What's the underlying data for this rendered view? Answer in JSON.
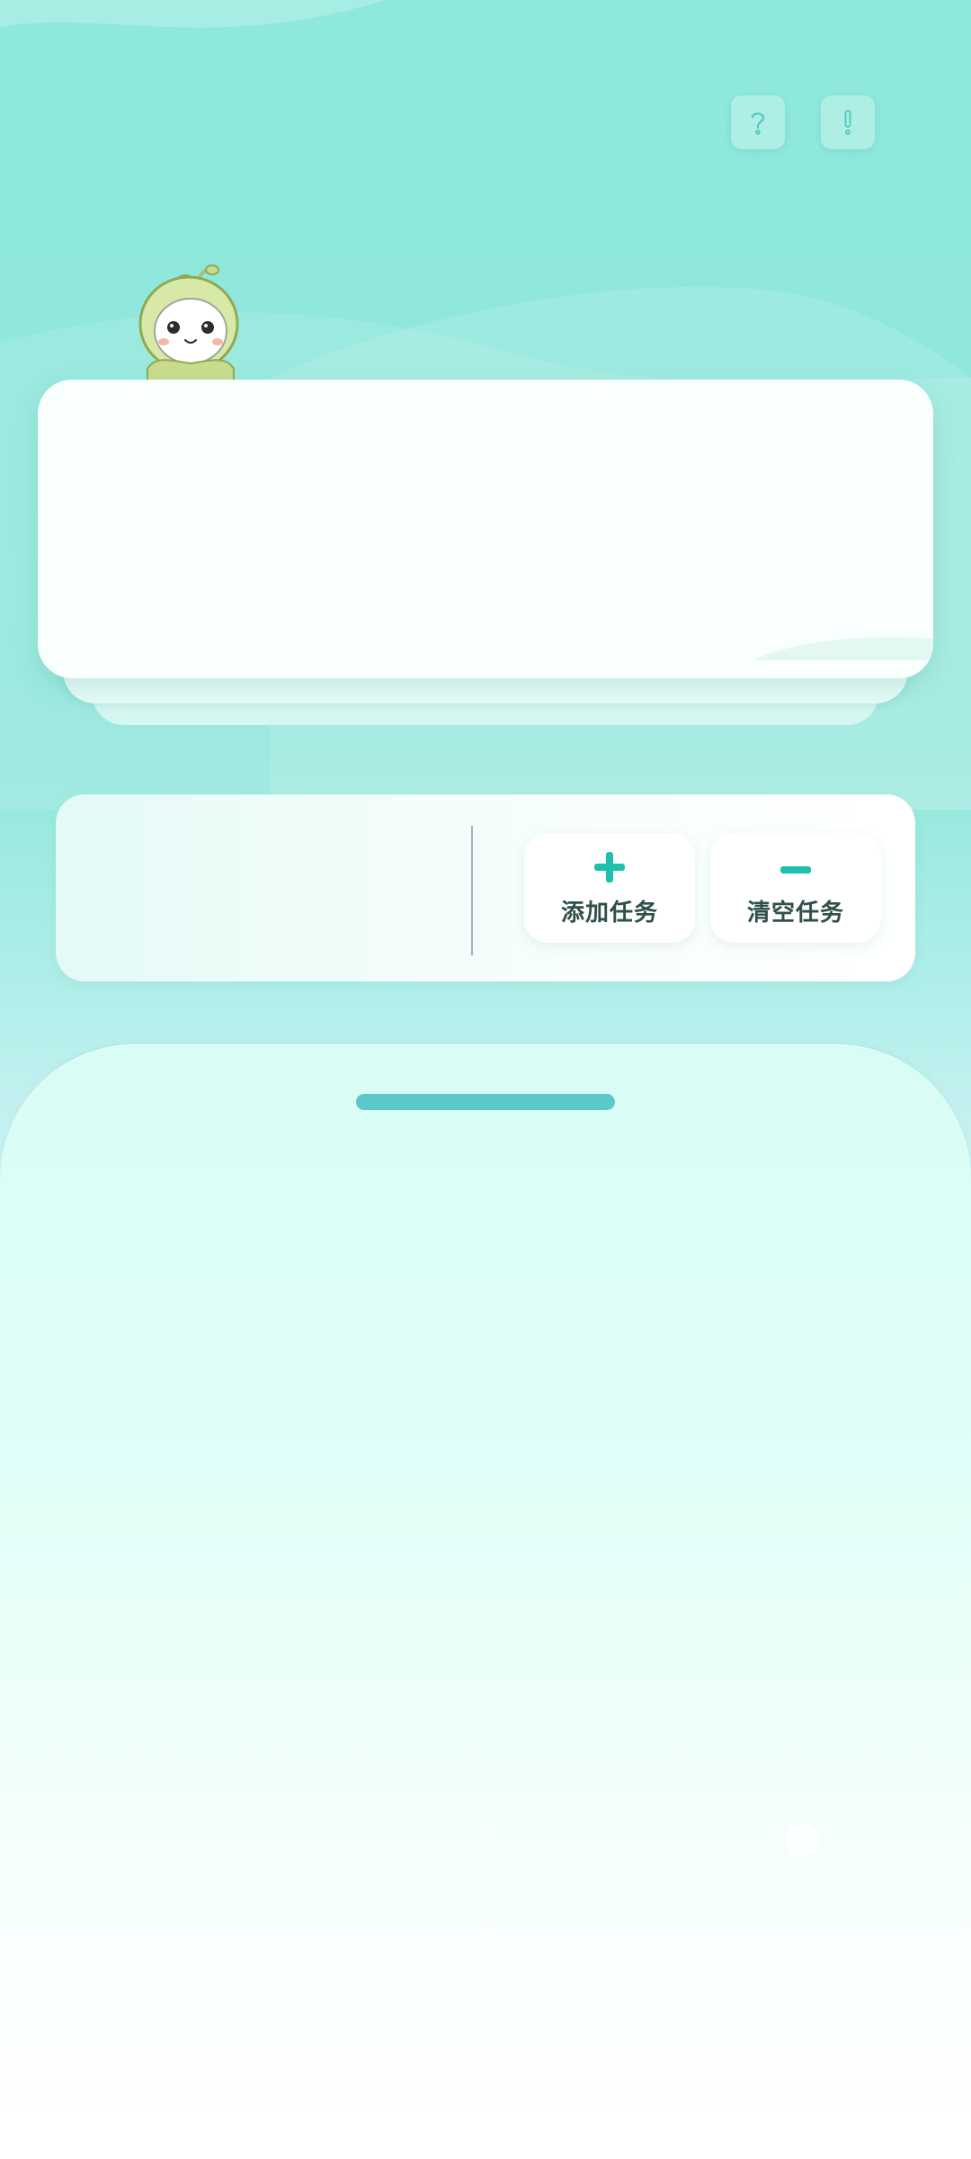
{
  "header": {
    "help_icon": "question-mark-icon",
    "info_icon": "exclamation-icon"
  },
  "mascot": {
    "icon": "sprout-mascot"
  },
  "actions": {
    "add_task": {
      "label": "添加任务",
      "icon": "plus-icon"
    },
    "clear_tasks": {
      "label": "清空任务",
      "icon": "minus-icon"
    }
  },
  "colors": {
    "accent": "#1fbfae",
    "handle": "#5bc9cb",
    "label_text": "#2f4f4a",
    "background_top": "#8ee8dc"
  }
}
